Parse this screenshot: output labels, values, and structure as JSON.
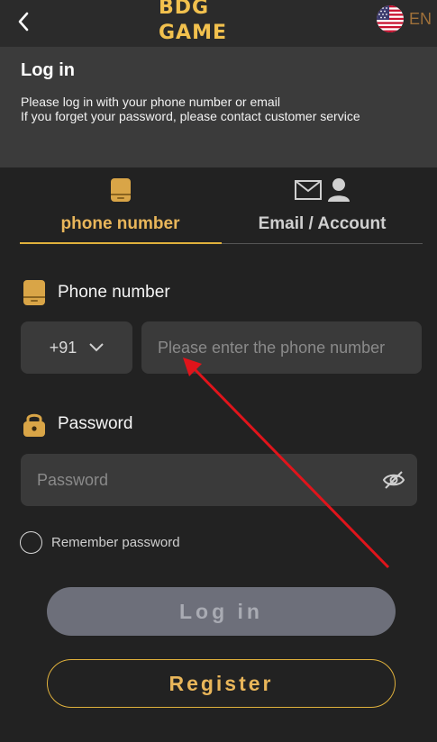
{
  "header": {
    "logo_text": "BDG GAME",
    "language": "EN",
    "flag_icon": "us-flag-icon",
    "back_icon": "chevron-left-icon"
  },
  "intro": {
    "title": "Log in",
    "line1": "Please log in with your phone number or email",
    "line2": "If you forget your password, please contact customer service"
  },
  "tabs": [
    {
      "label": "phone number",
      "icon": "phone-icon",
      "active": true
    },
    {
      "label": "Email / Account",
      "icon": "mail-user-icon",
      "active": false
    }
  ],
  "phone": {
    "label": "Phone number",
    "icon": "phone-icon",
    "country_code": "+91",
    "value": "",
    "placeholder": "Please enter the phone number"
  },
  "password": {
    "label": "Password",
    "icon": "lock-icon",
    "value": "",
    "placeholder": "Password",
    "toggle_icon": "eye-slash-icon"
  },
  "remember": {
    "label": "Remember password",
    "checked": false
  },
  "buttons": {
    "login": "Log in",
    "register": "Register"
  },
  "colors": {
    "accent": "#e0b13c",
    "background": "#222222",
    "panel": "#3b3b3b",
    "annotation_arrow": "#e0141b"
  }
}
